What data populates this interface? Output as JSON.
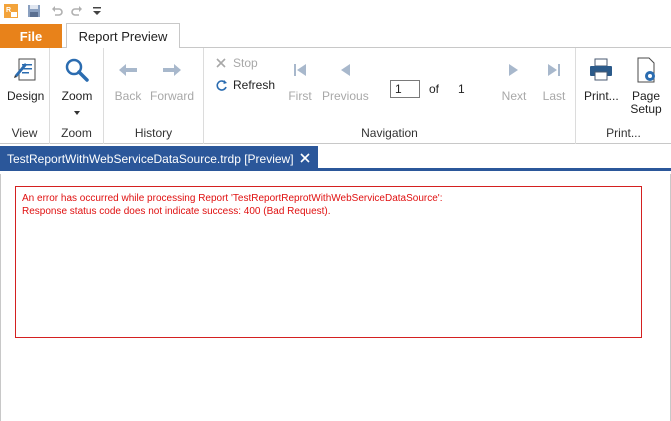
{
  "qat": {
    "icons": [
      "app-logo-icon",
      "save-icon",
      "undo-icon",
      "redo-icon",
      "customize-dropdown-icon"
    ]
  },
  "tabs": {
    "file": "File",
    "report_preview": "Report Preview"
  },
  "ribbon": {
    "view": {
      "label": "View",
      "design": "Design"
    },
    "zoom": {
      "label": "Zoom",
      "zoom": "Zoom"
    },
    "history": {
      "label": "History",
      "back": "Back",
      "forward": "Forward"
    },
    "navigation": {
      "label": "Navigation",
      "stop": "Stop",
      "refresh": "Refresh",
      "first": "First",
      "previous": "Previous",
      "page_value": "1",
      "of_label": "of",
      "total_pages": "1",
      "next": "Next",
      "last": "Last"
    },
    "print": {
      "label": "Print...",
      "print": "Print...",
      "page_setup_line1": "Page",
      "page_setup_line2": "Setup"
    }
  },
  "document": {
    "tab_title": "TestReportWithWebServiceDataSource.trdp [Preview]"
  },
  "error": {
    "line1": "An error has occurred while processing Report 'TestReportReprotWithWebServiceDataSource':",
    "line2": "Response status code does not indicate success: 400 (Bad Request)."
  },
  "colors": {
    "file_tab": "#e8821a",
    "doc_tab": "#2b579a",
    "error_text": "#e01010",
    "error_border": "#d42020",
    "icon_blue": "#2b6cb0"
  }
}
